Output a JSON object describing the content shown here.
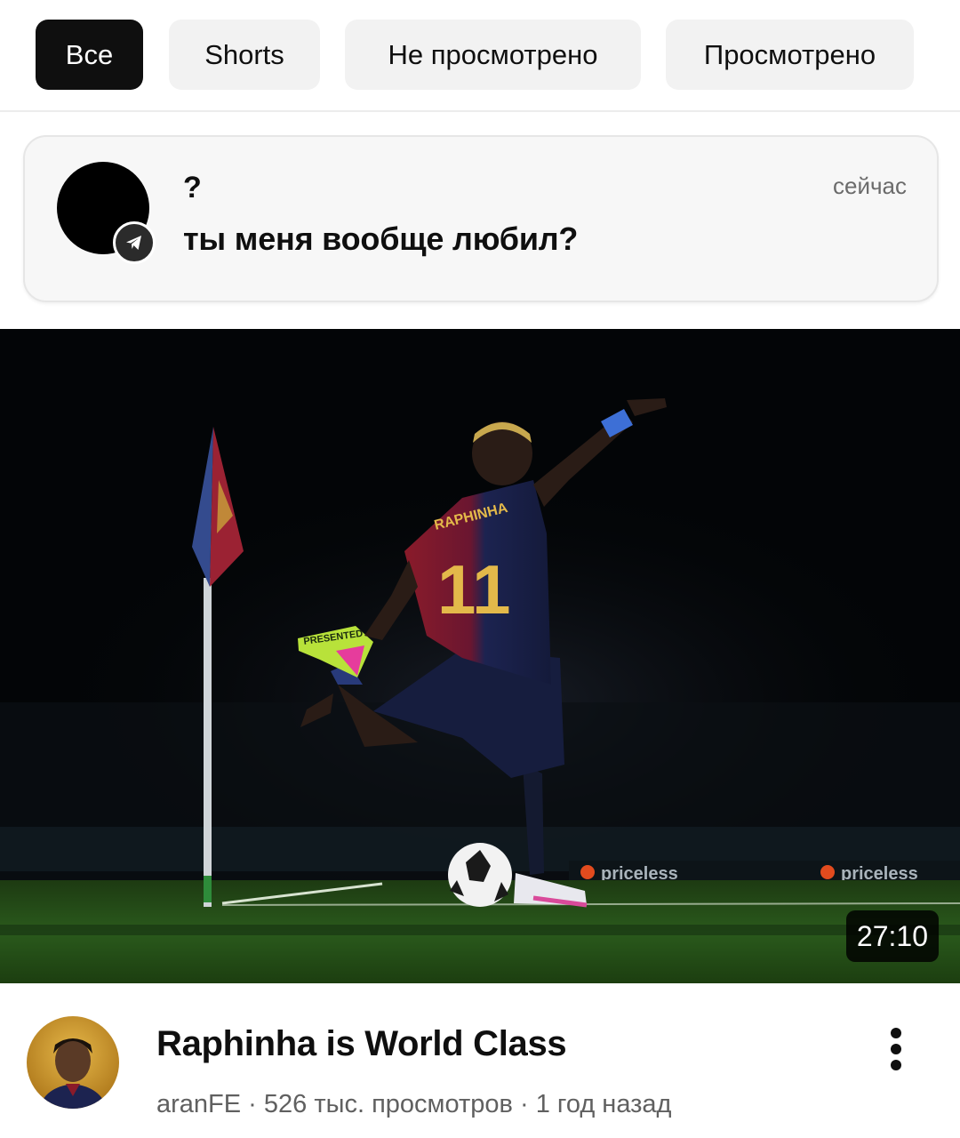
{
  "filters": [
    {
      "label": "Все",
      "active": true
    },
    {
      "label": "Shorts",
      "active": false
    },
    {
      "label": "Не просмотрено",
      "active": false
    },
    {
      "label": "Просмотрено",
      "active": false
    }
  ],
  "notification": {
    "sender": "?",
    "message": "ты меня вообще любил?",
    "time": "сейчас",
    "app_icon": "telegram-icon"
  },
  "video": {
    "duration": "27:10",
    "title": "Raphinha is World Class",
    "channel": "aranFE",
    "views": "526 тыс. просмотров",
    "age": "1 год назад",
    "separator": " · ",
    "thumbnail": {
      "jersey_name": "RAPHINHA",
      "jersey_number": "11",
      "boot_text": "PRESENTED",
      "board_text_1": "priceless",
      "board_text_2": "priceless"
    }
  },
  "colors": {
    "active_chip": "#0f0f0f",
    "chip": "#f2f2f2",
    "secondary_text": "#606060"
  }
}
